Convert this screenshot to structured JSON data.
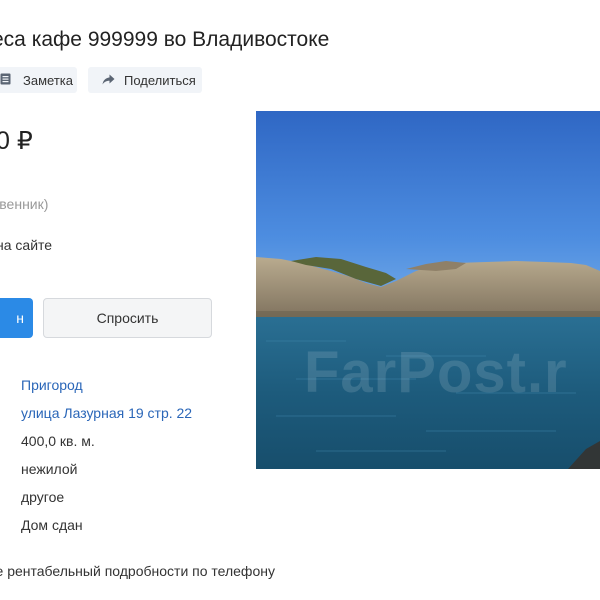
{
  "header": {
    "title": "еса кафе 999999 во Владивостоке"
  },
  "actions": {
    "note_label": "Заметка",
    "share_label": "Поделиться"
  },
  "listing": {
    "price": "0 ₽",
    "seller_type": "бственник)",
    "on_site": "на сайте"
  },
  "buttons": {
    "primary_label": "н",
    "ask_label": "Спросить"
  },
  "details": [
    {
      "value": "Пригород",
      "link": true
    },
    {
      "value": "улица Лазурная 19 стр. 22",
      "link": true
    },
    {
      "value": "400,0 кв. м.",
      "link": false
    },
    {
      "value": "нежилой",
      "link": false
    },
    {
      "value": "другое",
      "link": false
    },
    {
      "value": "Дом сдан",
      "link": false
    }
  ],
  "description": "фе рентабельный подробности по телефону",
  "photo": {
    "watermark": "FarPost.r"
  },
  "colors": {
    "link": "#2a66b8",
    "primary_button": "#2b8ae6"
  }
}
